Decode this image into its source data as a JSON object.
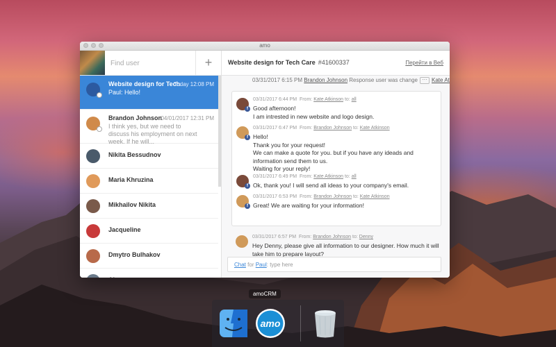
{
  "window": {
    "title": "amo"
  },
  "sidebar": {
    "search_placeholder": "Find user",
    "add_icon": "plus-icon",
    "items": [
      {
        "name": "Website design for Tech C...",
        "time": "Today 12:08 PM",
        "preview": "Paul: Hello!",
        "active": true,
        "avatar_color": "#2c5aa0"
      },
      {
        "name": "Brandon Johnson",
        "time": "04/01/2017 12:31 PM",
        "preview": "I think yes, but we need to discuss his employment on next week. If he will...",
        "active": false,
        "avatar_color": "#d08a4a"
      },
      {
        "name": "Nikita Bessudnov",
        "time": "",
        "preview": "",
        "active": false,
        "avatar_color": "#4a5a6a"
      },
      {
        "name": "Maria Khruzina",
        "time": "",
        "preview": "",
        "active": false,
        "avatar_color": "#e09a5a"
      },
      {
        "name": "Mikhailov Nikita",
        "time": "",
        "preview": "",
        "active": false,
        "avatar_color": "#7a5a4a"
      },
      {
        "name": "Jacqueline",
        "time": "",
        "preview": "",
        "active": false,
        "avatar_color": "#c83a3a"
      },
      {
        "name": "Dmytro Bulhakov",
        "time": "",
        "preview": "",
        "active": false,
        "avatar_color": "#b86a4a"
      },
      {
        "name": "Alexey",
        "time": "",
        "preview": "",
        "active": false,
        "avatar_color": "#6a7a8a"
      }
    ]
  },
  "main": {
    "title": "Website design for Tech Care",
    "id": "#41600337",
    "open_web_link": "Перейти в Веб",
    "system_line": {
      "date": "03/31/2017 6:15 PM",
      "actor": "Brandon Johnson",
      "text": "Response user was change",
      "target": "Kate Atkinson"
    },
    "thread": [
      {
        "meta_date": "03/31/2017 6:44 PM",
        "from_label": "From:",
        "from": "Kate Atkinson",
        "to_label": "to:",
        "to": "all",
        "text": "Good afternoon!\nI am intrested in new website and logo design.",
        "avatar_color": "#7a4a3a"
      },
      {
        "meta_date": "03/31/2017 6:47 PM",
        "from_label": "From:",
        "from": "Brandon Johnson",
        "to_label": "to:",
        "to": "Kate Atkinson",
        "text": "Hello!\nThank you for your request!\nWe can make a quote for you. but if you have any ideads and information send them to us.\nWaiting for your reply!",
        "avatar_color": "#d09a5a"
      },
      {
        "meta_date": "03/31/2017 6:49 PM",
        "from_label": "From:",
        "from": "Kate Atkinson",
        "to_label": "to:",
        "to": "all",
        "text": "Ok, thank you! I will send all ideas to your company's email.",
        "avatar_color": "#7a4a3a"
      },
      {
        "meta_date": "03/31/2017 6:53 PM",
        "from_label": "From:",
        "from": "Brandon Johnson",
        "to_label": "to:",
        "to": "Kate Atkinson",
        "text": "Great! We are waiting for your information!",
        "avatar_color": "#d09a5a"
      }
    ],
    "outgoing": {
      "meta_date": "03/31/2017 6:57 PM",
      "from_label": "From:",
      "from": "Brandon Johnson",
      "to_label": "to:",
      "to": "Denny",
      "text": "Hey Denny, please give all information to our designer. How much it will take him to prepare layout?",
      "avatar_color": "#d09a5a"
    },
    "composer": {
      "chat": "Chat",
      "for": "for",
      "user": "Paul",
      "placeholder": "type here"
    }
  },
  "dock": {
    "label": "amoCRM",
    "amo_text": "amo",
    "icons": [
      "finder-icon",
      "amocrm-icon",
      "trash-icon"
    ]
  }
}
